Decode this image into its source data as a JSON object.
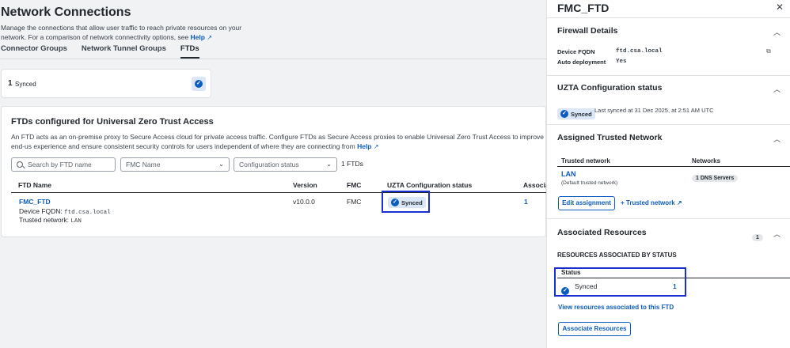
{
  "main": {
    "title": "Network Connections",
    "description": "Manage the connections that allow user traffic to reach private resources on your network. For a comparison of network connectivity options, see",
    "help_link": "Help",
    "tabs": [
      {
        "label": "Connector Groups"
      },
      {
        "label": "Network Tunnel Groups"
      },
      {
        "label": "FTDs"
      }
    ],
    "synced_card": {
      "count": "1",
      "label": "Synced"
    },
    "ftd_section": {
      "title": "FTDs configured for Universal Zero Trust Access",
      "description": "An FTD acts as an on-premise proxy to Secure Access cloud for private access traffic. Configure FTDs as Secure Access proxies to enable Universal Zero Trust Access to improve end-us experience and ensure consistent security controls for users independent of where they are connecting from",
      "help_link": "Help",
      "search_placeholder": "Search by FTD name",
      "fmc_filter": "FMC Name",
      "config_filter": "Configuration status",
      "count": "1 FTDs",
      "columns": [
        "FTD Name",
        "Version",
        "FMC",
        "UZTA Configuration status",
        "Associa"
      ],
      "row": {
        "name": "FMC_FTD",
        "fqdn_label": "Device FQDN:",
        "fqdn_value": "ftd.csa.local",
        "network_label": "Trusted network:",
        "network_value": "LAN",
        "version": "v10.0.0",
        "fmc": "FMC",
        "status": "Synced",
        "assoc": "1"
      }
    }
  },
  "panel": {
    "title": "FMC_FTD",
    "firewall": {
      "title": "Firewall Details",
      "fqdn_label": "Device FQDN",
      "fqdn_value": "ftd.csa.local",
      "auto_label": "Auto deployment",
      "auto_value": "Yes"
    },
    "uzta": {
      "title": "UZTA Configuration status",
      "status": "Synced",
      "last_synced": "Last synced at 31 Dec 2025, at 2:51 AM UTC"
    },
    "trusted": {
      "title": "Assigned Trusted Network",
      "col1": "Trusted network",
      "col2": "Networks",
      "name": "LAN",
      "sub": "(Default trusted network)",
      "networks": "1 DNS Servers",
      "edit_label": "Edit assignment",
      "add_label": "Trusted network"
    },
    "resources": {
      "title": "Associated Resources",
      "badge": "1",
      "subtitle": "RESOURCES ASSOCIATED BY STATUS",
      "col": "Status",
      "row_status": "Synced",
      "row_count": "1",
      "view_link": "View resources associated to this FTD",
      "assoc_button": "Associate Resources"
    }
  }
}
